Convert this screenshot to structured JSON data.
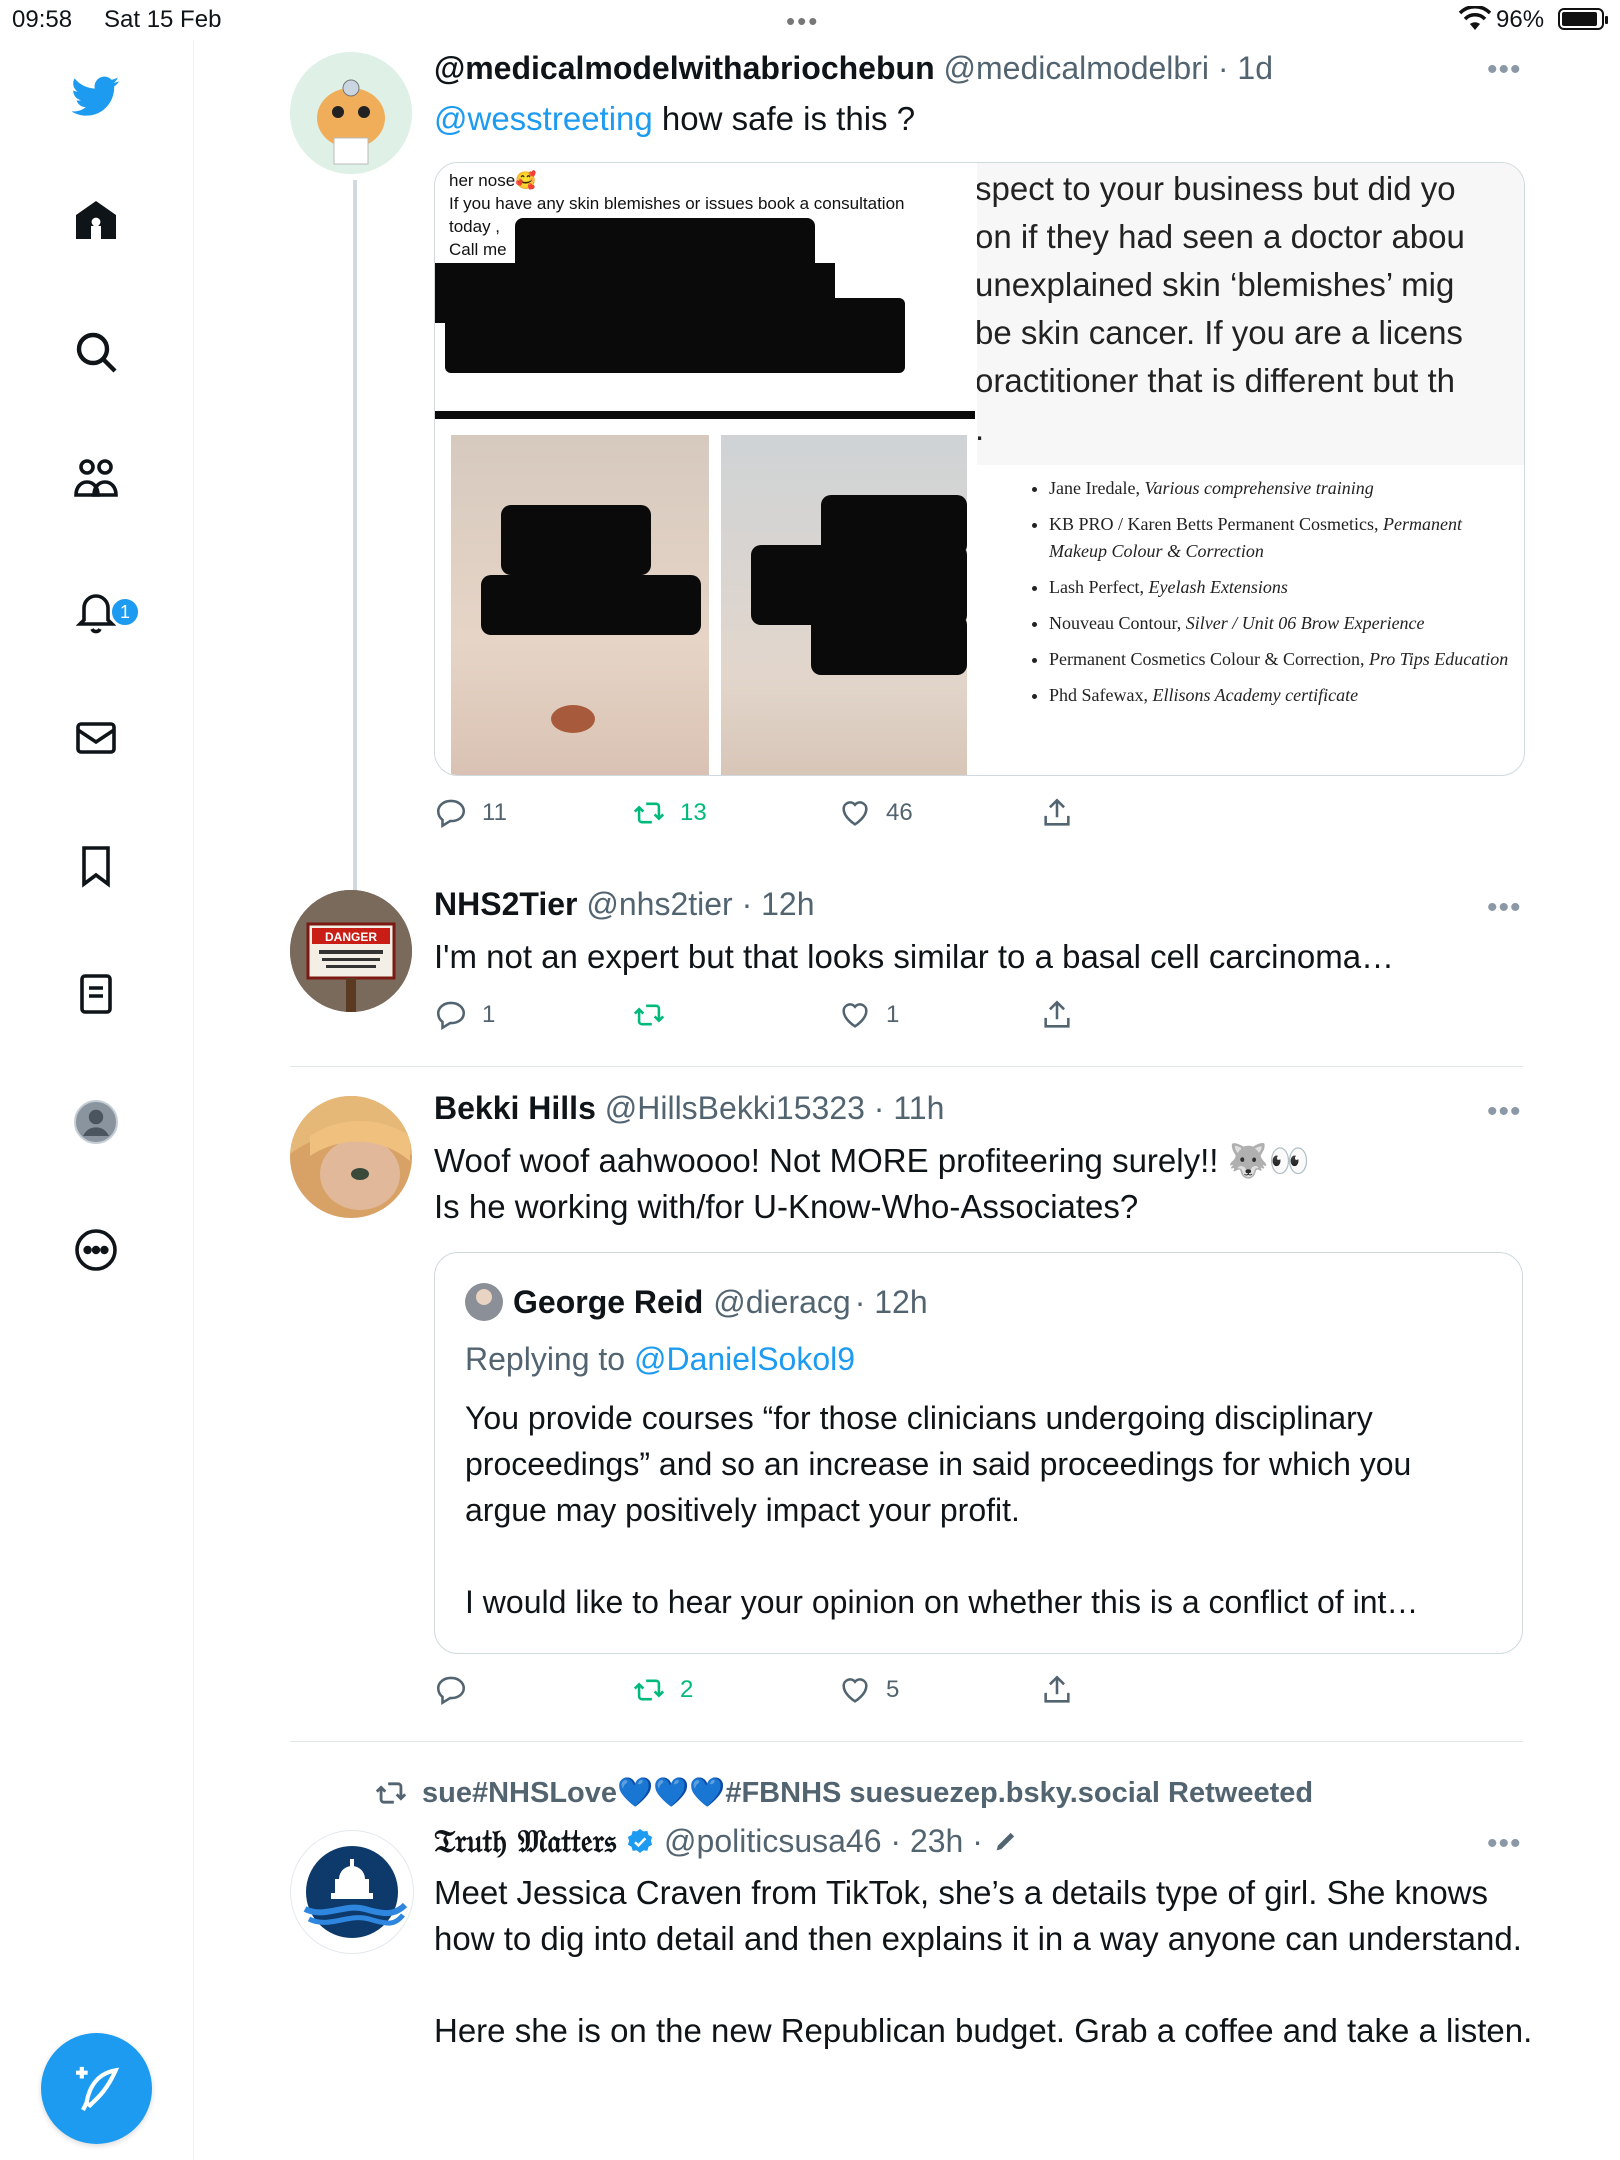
{
  "status_bar": {
    "time": "09:58",
    "date": "Sat 15 Feb",
    "battery": "96%"
  },
  "notifications_badge": "1",
  "tweets": [
    {
      "name": "@medicalmodelwithabriochebun",
      "handle": "@medicalmodelbri",
      "time": "· 1d",
      "mention": "@wesstreeting",
      "text": " how safe is this ?",
      "media": {
        "caption_lines": [
          "her nose🥰",
          "If you have any skin blemishes or issues book a consultation",
          "today ,",
          "Call me"
        ],
        "right_text_lines": [
          "spect to your business but did yo",
          "on if they had seen a doctor abou",
          " unexplained skin ‘blemishes’ mig",
          "be skin cancer. If you are a licens",
          "oractitioner that is different but th",
          "."
        ],
        "credentials": [
          {
            "name": "Jane Iredale, ",
            "detail": "Various comprehensive training"
          },
          {
            "name": "KB PRO / Karen Betts Permanent Cosmetics, ",
            "detail": "Permanent Makeup Colour & Correction"
          },
          {
            "name": "Lash Perfect, ",
            "detail": "Eyelash Extensions"
          },
          {
            "name": "Nouveau Contour, ",
            "detail": "Silver / Unit 06 Brow Experience"
          },
          {
            "name": "Permanent Cosmetics Colour & Correction, ",
            "detail": "Pro Tips Education"
          },
          {
            "name": "Phd Safewax, ",
            "detail": "Ellisons Academy certificate"
          }
        ]
      },
      "replies": "11",
      "retweets": "13",
      "likes": "46"
    },
    {
      "name": "NHS2Tier",
      "handle": "@nhs2tier",
      "time": "· 12h",
      "text": "I'm not an expert but that looks similar to a basal cell carcinoma…",
      "avatar_sign": {
        "top": "DANGER",
        "bottom": "AUTHORIZED PERSONNEL ONLY BEYOND THIS POINT"
      },
      "replies": "1",
      "retweets": "",
      "likes": "1"
    },
    {
      "name": "Bekki Hills",
      "handle": "@HillsBekki15323",
      "time": "· 11h",
      "text_line1": "Woof woof aahwoooo! Not MORE profiteering surely!! 🐺👀",
      "text_line2": "Is he working with/for U-Know-Who-Associates?",
      "quote": {
        "name": "George Reid",
        "handle": "@dieracg",
        "time": "· 12h",
        "replying_prefix": "Replying to ",
        "replying_to": "@DanielSokol9",
        "para1": "You provide courses “for those clinicians undergoing disciplinary proceedings” and so an increase in said proceedings for which you argue may positively impact your profit.",
        "para2": "I would like to hear your opinion on whether this is a conflict of int…"
      },
      "replies": "",
      "retweets": "2",
      "likes": "5"
    },
    {
      "retweeted_by": "sue#NHSLove💙💙💙#FBNHS suesuezep.bsky.social Retweeted",
      "name": "𝔗𝔯𝔲𝔱𝔥 𝔐𝔞𝔱𝔱𝔢𝔯𝔰",
      "handle": "@politicsusa46",
      "time": "· 23h ·",
      "para1": "Meet Jessica Craven from TikTok, she’s a details type of girl. She knows how to dig into detail and then explains it in a way anyone can understand.",
      "para2": "Here she is on the new Republican budget. Grab a coffee and take a listen."
    }
  ],
  "colors": {
    "accent": "#1d9bf0",
    "retweet_green": "#00ba7c",
    "muted": "#536471"
  }
}
